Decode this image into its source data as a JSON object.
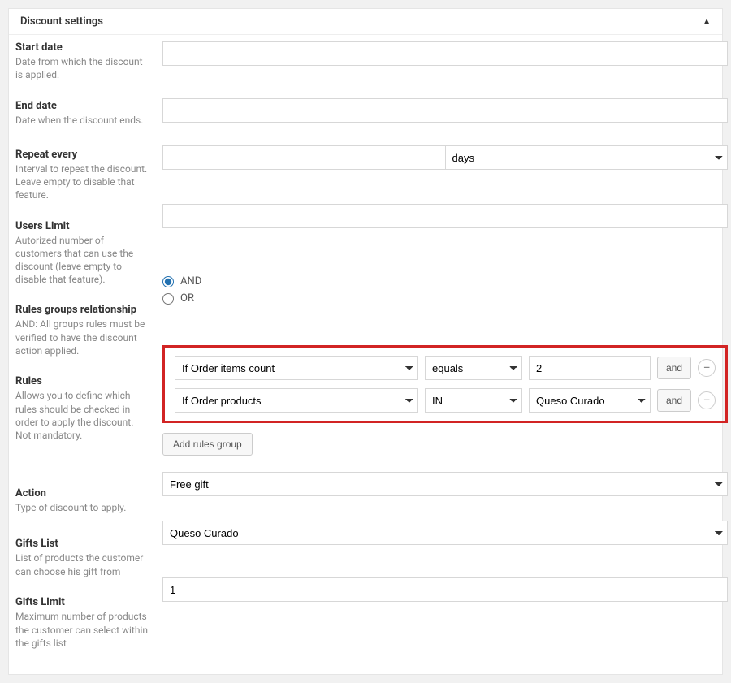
{
  "panel": {
    "title": "Discount settings"
  },
  "fields": {
    "start_date": {
      "label": "Start date",
      "desc": "Date from which the discount is applied.",
      "value": ""
    },
    "end_date": {
      "label": "End date",
      "desc": "Date when the discount ends.",
      "value": ""
    },
    "repeat": {
      "label": "Repeat every",
      "desc": "Interval to repeat the discount. Leave empty to disable that feature.",
      "value": "",
      "unit": "days"
    },
    "users_limit": {
      "label": "Users Limit",
      "desc": "Autorized number of customers that can use the discount (leave empty to disable that feature).",
      "value": ""
    },
    "relationship": {
      "label": "Rules groups relationship",
      "desc": "AND: All groups rules must be verified to have the discount action applied.",
      "options": {
        "and": "AND",
        "or": "OR"
      },
      "selected": "and"
    },
    "rules": {
      "label": "Rules",
      "desc": "Allows you to define which rules should be checked in order to apply the discount. Not mandatory.",
      "rows": [
        {
          "cond": "If Order items count",
          "op": "equals",
          "val": "2",
          "logic": "and"
        },
        {
          "cond": "If Order products",
          "op": "IN",
          "val": "Queso Curado",
          "logic": "and"
        }
      ],
      "add_group_label": "Add rules group"
    },
    "action": {
      "label": "Action",
      "desc": "Type of discount to apply.",
      "value": "Free gift"
    },
    "gifts_list": {
      "label": "Gifts List",
      "desc": "List of products the customer can choose his gift from",
      "value": "Queso Curado"
    },
    "gifts_limit": {
      "label": "Gifts Limit",
      "desc": "Maximum number of products the customer can select within the gifts list",
      "value": "1"
    }
  }
}
